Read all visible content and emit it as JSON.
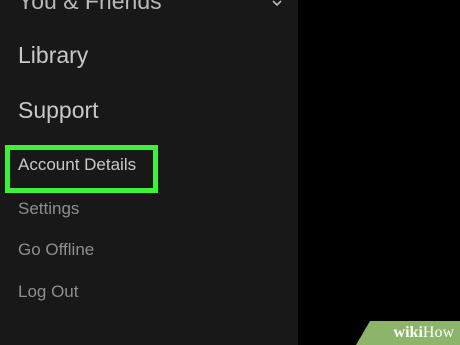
{
  "sidebar": {
    "section_top": "You & Friends",
    "library": "Library",
    "support": "Support",
    "account_details": "Account Details",
    "settings": "Settings",
    "go_offline": "Go Offline",
    "log_out": "Log Out"
  },
  "watermark": {
    "wiki": "wiki",
    "how": "How"
  },
  "colors": {
    "sidebar_bg": "#181818",
    "highlight": "#3cf03c",
    "watermark_bg": "#8cb46a"
  }
}
